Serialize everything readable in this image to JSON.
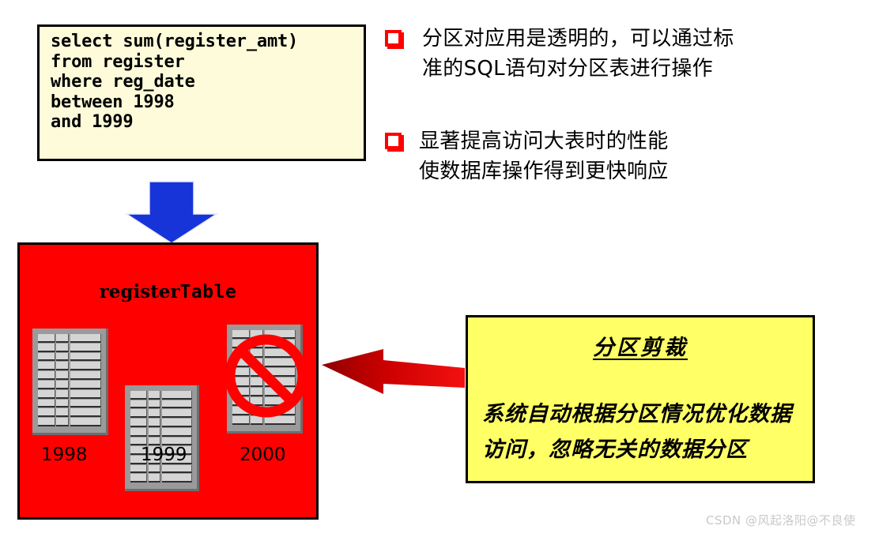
{
  "sql_box": {
    "lines": [
      "select sum(register_amt)",
      "from register",
      "where reg_date",
      "between 1998",
      "and 1999"
    ],
    "background_color": "#fdfbd9",
    "border_color": "#000000"
  },
  "bullets": [
    {
      "marker": "red-square-bullet",
      "text": "分区对应用是透明的，可以通过标\n准的SQL语句对分区表进行操作"
    },
    {
      "marker": "red-square-bullet",
      "text": "显著提高访问大表时的性能\n使数据库操作得到更快响应"
    }
  ],
  "diagram": {
    "down_arrow_color": "#1634d8",
    "register_box": {
      "background_color": "#ff0000",
      "title_serif": "register",
      "title_mono": "Table",
      "partitions": [
        {
          "year_label": "1998",
          "pruned": false
        },
        {
          "year_label": "1999",
          "pruned": false
        },
        {
          "year_label": "2000",
          "pruned": true
        }
      ]
    },
    "left_arrow_color": "#cc0000"
  },
  "callout": {
    "title": "分区剪裁",
    "body": "系统自动根据分区情况优化数据访问，忽略无关的数据分区",
    "background_color": "#ffff66",
    "border_color": "#000000"
  },
  "watermark": {
    "text": "CSDN @风起洛阳@不良使"
  }
}
